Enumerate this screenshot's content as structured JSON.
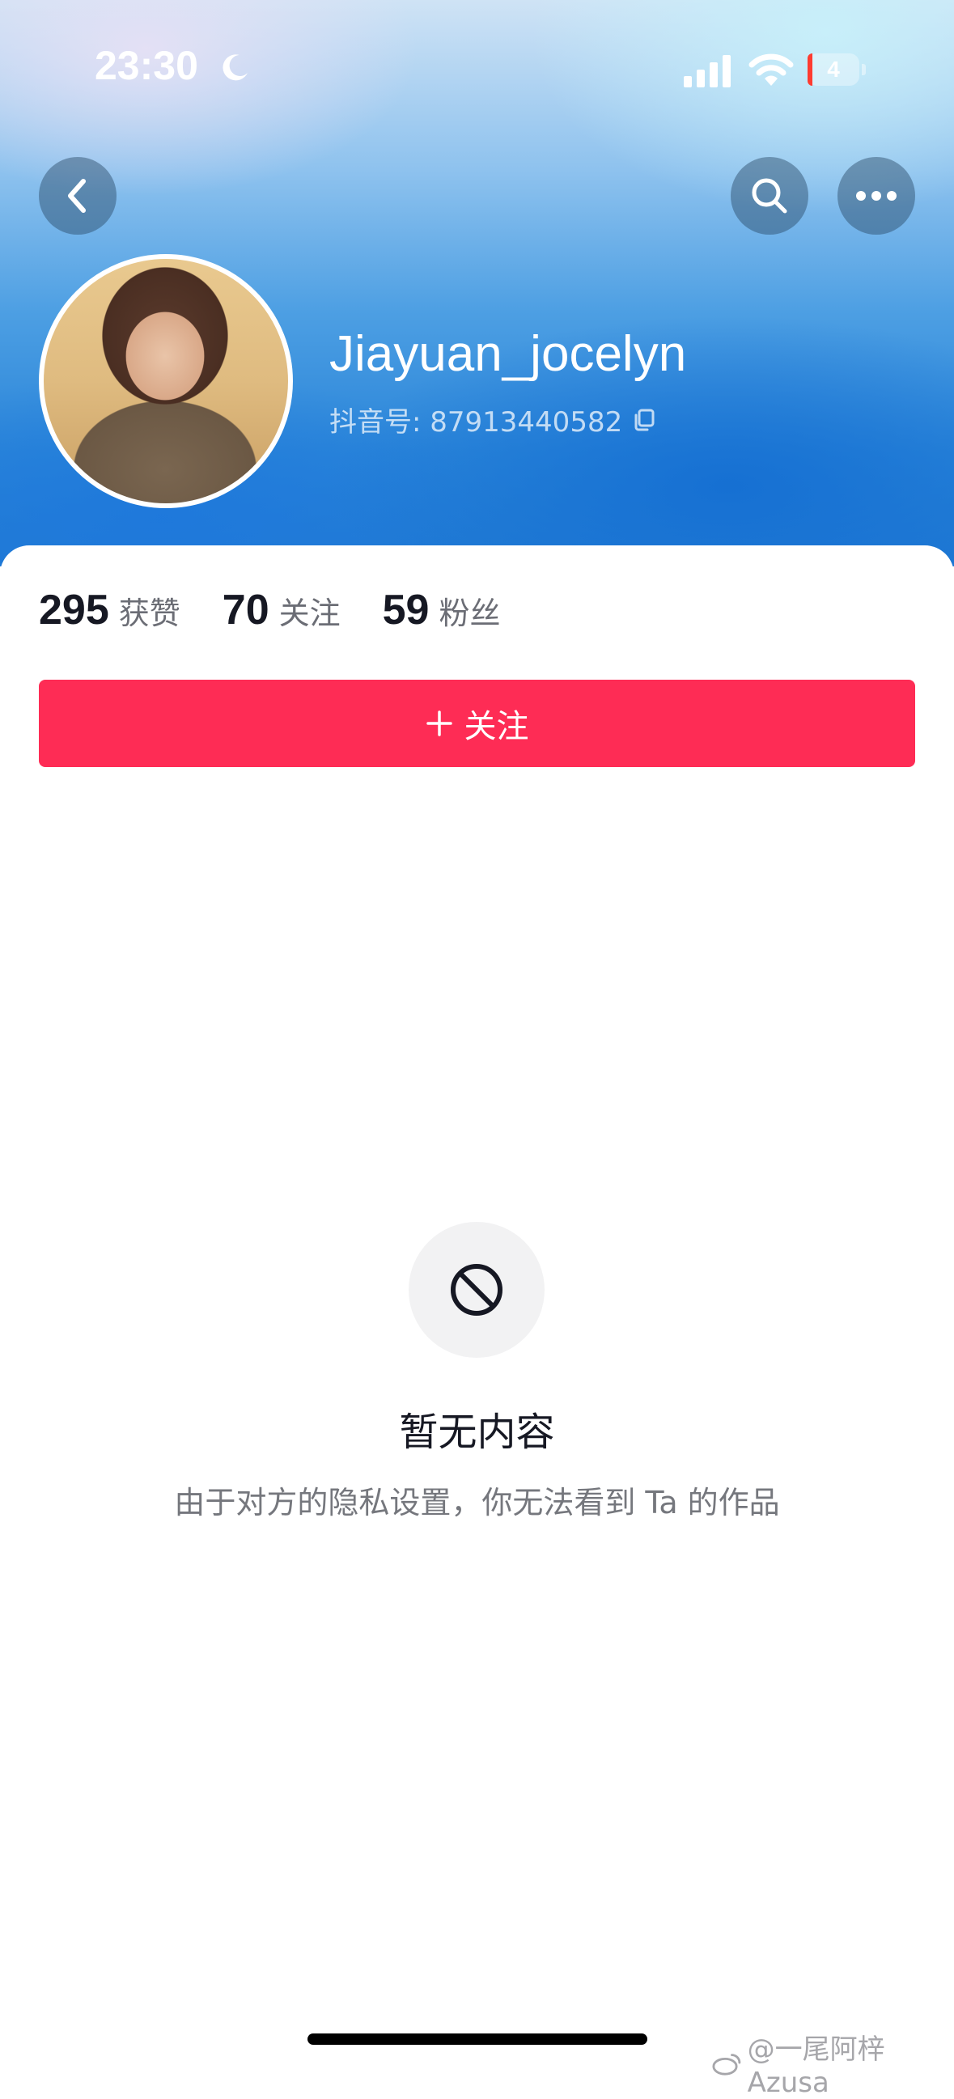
{
  "status_bar": {
    "time": "23:30",
    "battery_level": "4",
    "icons": [
      "moon-icon",
      "signal-icon",
      "wifi-icon",
      "battery-icon"
    ]
  },
  "nav": {
    "icons": [
      "chevron-left-icon",
      "search-icon",
      "more-icon"
    ]
  },
  "profile": {
    "username": "Jiayuan_jocelyn",
    "douyin_id_label": "抖音号: 87913440582"
  },
  "stats": [
    {
      "value": "295",
      "label": "获赞"
    },
    {
      "value": "70",
      "label": "关注"
    },
    {
      "value": "59",
      "label": "粉丝"
    }
  ],
  "follow_button": {
    "label": "关注"
  },
  "empty_state": {
    "title": "暂无内容",
    "description": "由于对方的隐私设置，你无法看到 Ta 的作品",
    "icon": "blocked-icon"
  },
  "watermark": {
    "text": "@一尾阿梓Azusa"
  },
  "colors": {
    "accent": "#fe2c55",
    "text_primary": "#161823",
    "text_secondary": "#75777d"
  }
}
